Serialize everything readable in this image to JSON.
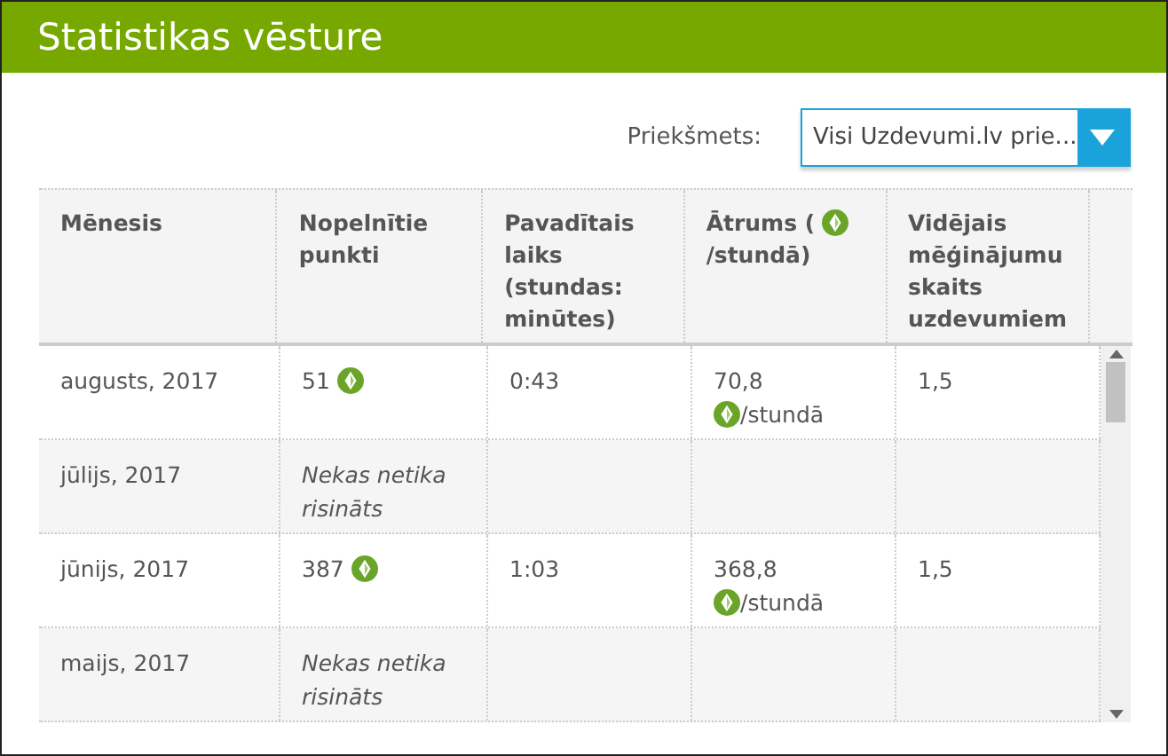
{
  "title": "Statistikas vēsture",
  "filter": {
    "label": "Priekšmets:",
    "value": "Visi Uzdevumi.lv prie..."
  },
  "table": {
    "columns": [
      {
        "label": "Mēnesis"
      },
      {
        "label": "Nopelnītie punkti"
      },
      {
        "label": "Pavadītais laiks (stundas: minūtes)"
      },
      {
        "label": "Ātrums (",
        "unit": "/stundā)"
      },
      {
        "label": "Vidējais mēģinājumu skaits uzdevumiem"
      }
    ],
    "rows": [
      {
        "cells": [
          {
            "text": "augusts, 2017"
          },
          {
            "text": "51",
            "gem": true
          },
          {
            "text": "0:43"
          },
          {
            "text": "70,8",
            "unit": "/stundā"
          },
          {
            "text": "1,5"
          }
        ]
      },
      {
        "cells": [
          {
            "text": "jūlijs, 2017"
          },
          {
            "text": "Nekas netika risināts",
            "kind": "note"
          },
          null,
          null,
          null
        ]
      },
      {
        "cells": [
          {
            "text": "jūnijs, 2017"
          },
          {
            "text": "387",
            "gem": true
          },
          {
            "text": "1:03"
          },
          {
            "text": "368,8",
            "unit": "/stundā"
          },
          {
            "text": "1,5"
          }
        ]
      },
      {
        "cells": [
          {
            "text": "maijs, 2017"
          },
          {
            "text": "Nekas netika risināts",
            "kind": "note"
          },
          null,
          null,
          null
        ]
      }
    ]
  }
}
